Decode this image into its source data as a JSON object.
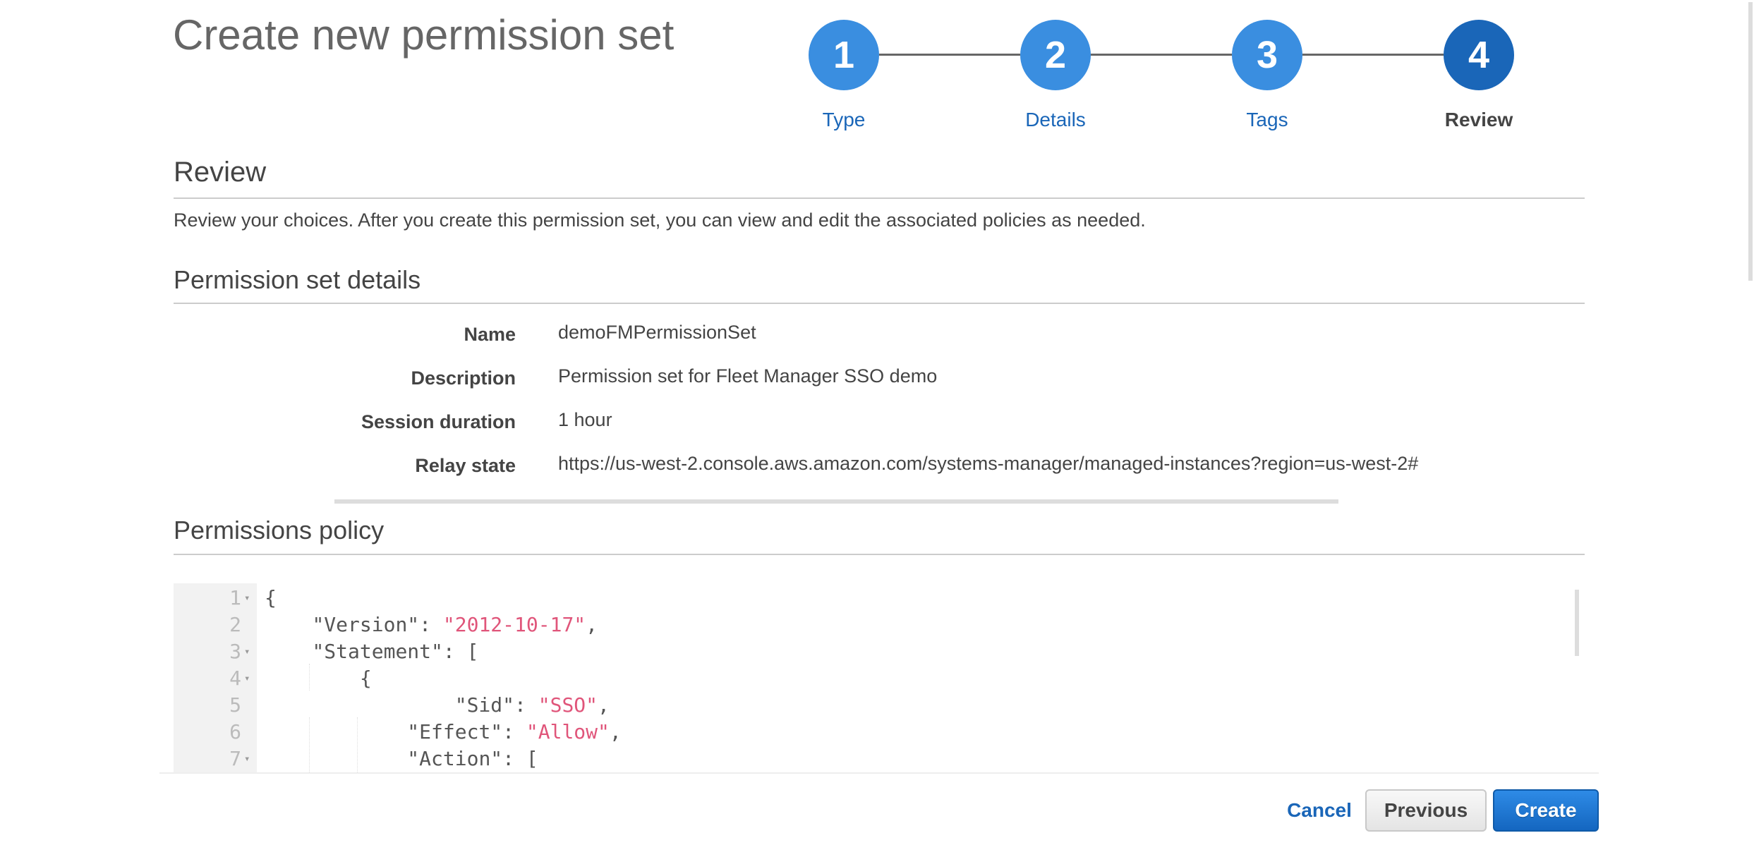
{
  "page": {
    "title": "Create new permission set"
  },
  "wizard": {
    "steps": [
      {
        "number": "1",
        "label": "Type",
        "state": "completed"
      },
      {
        "number": "2",
        "label": "Details",
        "state": "completed"
      },
      {
        "number": "3",
        "label": "Tags",
        "state": "completed"
      },
      {
        "number": "4",
        "label": "Review",
        "state": "current"
      }
    ]
  },
  "review": {
    "heading": "Review",
    "description": "Review your choices. After you create this permission set, you can view and edit the associated policies as needed."
  },
  "details": {
    "heading": "Permission set details",
    "rows": [
      {
        "label": "Name",
        "value": "demoFMPermissionSet"
      },
      {
        "label": "Description",
        "value": "Permission set for Fleet Manager SSO demo"
      },
      {
        "label": "Session duration",
        "value": "1 hour"
      },
      {
        "label": "Relay state",
        "value": "https://us-west-2.console.aws.amazon.com/systems-manager/managed-instances?region=us-west-2#"
      }
    ]
  },
  "policy": {
    "heading": "Permissions policy",
    "lines": [
      {
        "n": "1",
        "fold": true,
        "indent": "",
        "key": "",
        "sep": "",
        "str": "",
        "tail": "{"
      },
      {
        "n": "2",
        "fold": false,
        "indent": "    ",
        "key": "\"Version\"",
        "sep": ": ",
        "str": "\"2012-10-17\"",
        "tail": ","
      },
      {
        "n": "3",
        "fold": true,
        "indent": "    ",
        "key": "\"Statement\"",
        "sep": ": ",
        "str": "",
        "tail": "["
      },
      {
        "n": "4",
        "fold": true,
        "indent": "        ",
        "key": "",
        "sep": "",
        "str": "",
        "tail": "{"
      },
      {
        "n": "5",
        "fold": false,
        "indent": "                ",
        "key": "\"Sid\"",
        "sep": ": ",
        "str": "\"SSO\"",
        "tail": ","
      },
      {
        "n": "6",
        "fold": false,
        "indent": "            ",
        "key": "\"Effect\"",
        "sep": ": ",
        "str": "\"Allow\"",
        "tail": ","
      },
      {
        "n": "7",
        "fold": true,
        "indent": "            ",
        "key": "\"Action\"",
        "sep": ": ",
        "str": "",
        "tail": "["
      }
    ],
    "fold_icon": "▾"
  },
  "footer": {
    "cancel_label": "Cancel",
    "previous_label": "Previous",
    "create_label": "Create"
  },
  "colors": {
    "step_completed": "#3a8ee0",
    "step_current": "#1a66b8",
    "link": "#1a66b8",
    "string_token": "#e0557a",
    "primary_button": "#1466c0"
  }
}
